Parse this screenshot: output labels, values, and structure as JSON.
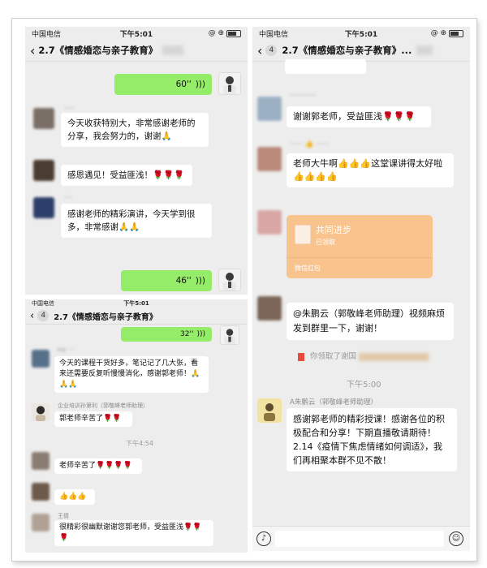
{
  "status": {
    "carrier": "中国电信",
    "time_top": "下午5:01",
    "time_bottom": "下午5:01",
    "indicator": "@ ⊕"
  },
  "nav": {
    "left_title": "2.7《情感婚恋与亲子教育》",
    "right_title": "2.7《情感婚恋与亲子教育》...",
    "badge": "4"
  },
  "left_top": {
    "voice1": "60''",
    "msg1": "今天收获特别大，非常感谢老师的分享，我会努力的，谢谢🙏",
    "msg2": "感恩遇见！受益匪浅！🌹🌹🌹",
    "msg3": "感谢老师的精彩演讲，今天学到很多，非常感谢🙏🙏",
    "voice2": "46''"
  },
  "left_bottom": {
    "voice1": "32''",
    "msg1": "今天的课程干货好多，笔记记了几大张，看来还需要反复听慢慢消化，感谢郭老师！🙏🙏🙏",
    "name2": "企业培训孙第利（郭敬峰老师助理）",
    "msg2": "郭老师辛苦了🌹🌹",
    "time": "下午4:54",
    "msg3": "老师辛苦了🌹🌹🌹🌹",
    "msg4": "👍👍👍",
    "name5": "王倩",
    "msg5": "很精彩很幽默谢谢您郭老师，受益匪浅🌹🌹🌹"
  },
  "right": {
    "msg1": "谢谢郭老师，受益匪浅🌹🌹🌹",
    "msg2": "老师大牛啊👍👍👍这堂课讲得太好啦👍👍👍👍",
    "redpacket_title": "共同进步",
    "redpacket_sub": "已领取",
    "redpacket_footer": "微信红包",
    "msg3": "@朱鹏云（郭敬峰老师助理）视频麻烦发到群里一下，谢谢！",
    "system": "你领取了谢国",
    "time": "下午5:00",
    "name5": "A朱鹏云（郭敬峰老师助理）",
    "msg5": "感谢郭老师的精彩授课！感谢各位的积极配合和分享！下期直播敬请期待！\n2.14《疫情下焦虑情绪如何调适》，我们再相聚本群不见不散！"
  },
  "icons": {
    "voice": "voice-input-icon",
    "emoji": "emoji-icon"
  },
  "colors": {
    "green_bubble": "#95ec69",
    "chat_bg": "#ededed",
    "redpacket": "#f9c38e"
  }
}
